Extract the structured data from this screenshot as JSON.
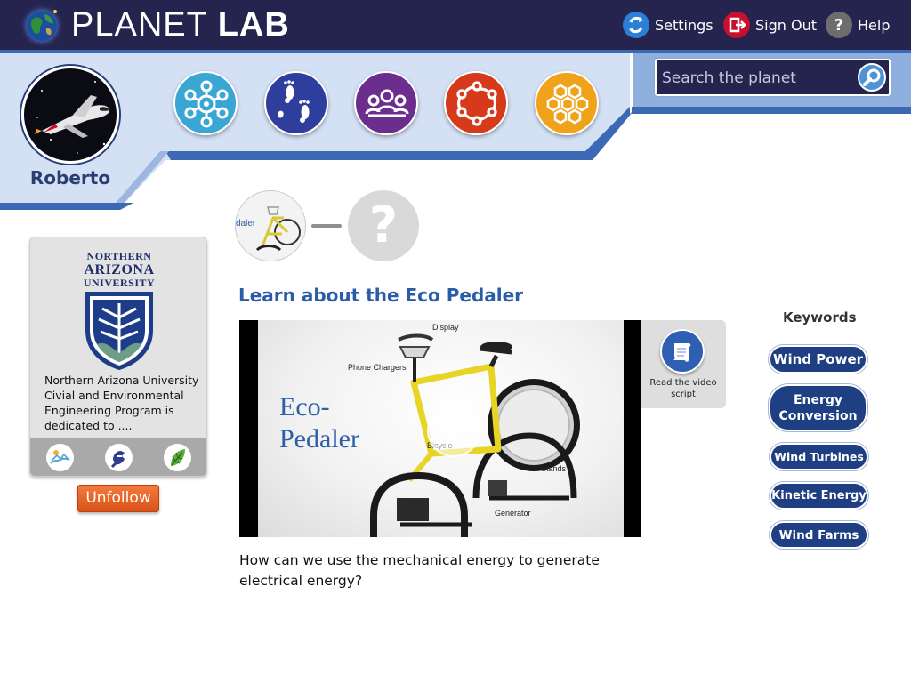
{
  "app": {
    "title_regular": "PLANET ",
    "title_bold": "LAB"
  },
  "topnav": {
    "settings": "Settings",
    "sign_out": "Sign Out",
    "help": "Help",
    "help_glyph": "?"
  },
  "user": {
    "name": "Roberto"
  },
  "categories": [
    {
      "icon": "network-eye-icon",
      "color": "#3aa6d4"
    },
    {
      "icon": "footprints-icon",
      "color": "#2e3e9c"
    },
    {
      "icon": "group-icon",
      "color": "#6b2e8f"
    },
    {
      "icon": "circle-of-people-icon",
      "color": "#d63a1b"
    },
    {
      "icon": "honeycomb-icon",
      "color": "#f0a21b"
    }
  ],
  "search": {
    "placeholder": "Search the planet"
  },
  "institution": {
    "name_line1": "NORTHERN",
    "name_line2": "ARIZONA",
    "name_line3": "UNIVERSITY",
    "description": "Northern Arizona University Civial and Environmental Engineering Program is dedicated to ....",
    "footer_icons": [
      "landscape-icon",
      "hand-tool-icon",
      "leaf-icon"
    ]
  },
  "follow": {
    "label": "Unfollow"
  },
  "progress": {
    "unknown_glyph": "?"
  },
  "lesson": {
    "title": "Learn about the Eco Pedaler",
    "video": {
      "title_line1": "Eco-",
      "title_line2": "Pedaler",
      "labels": {
        "display": "Display",
        "phone_chargers": "Phone Chargers",
        "bicycle": "Bicycle",
        "stands": "Stands",
        "generator": "Generator"
      },
      "thumb_label": "daler"
    },
    "script_label": "Read the video script",
    "question": "How can we use the mechanical energy to generate electrical energy?"
  },
  "keywords": {
    "title": "Keywords",
    "items": [
      "Wind Power",
      "Energy Conversion",
      "Wind Turbines",
      "Kinetic Energy",
      "Wind Farms"
    ]
  }
}
